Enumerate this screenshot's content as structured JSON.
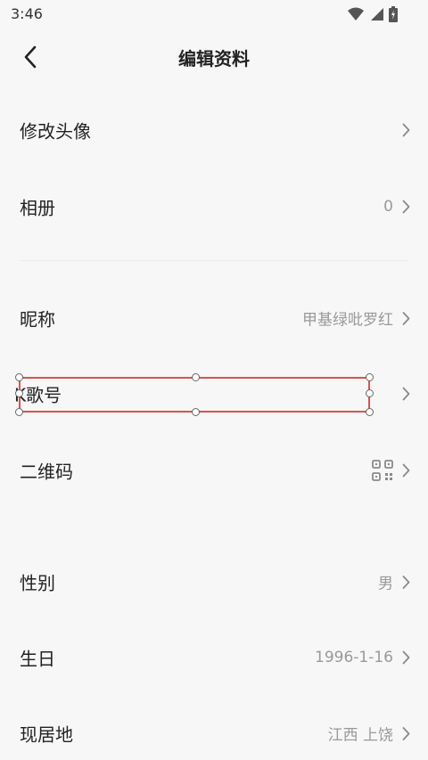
{
  "status_bar": {
    "time": "3:46"
  },
  "header": {
    "title": "编辑资料"
  },
  "rows": {
    "avatar": {
      "label": "修改头像"
    },
    "album": {
      "label": "相册",
      "value": "0"
    },
    "nickname": {
      "label": "昵称",
      "value": "甲基绿吡罗红"
    },
    "k_id": {
      "label": "K歌号"
    },
    "qr_code": {
      "label": "二维码",
      "icon": "qr-code-icon"
    },
    "gender": {
      "label": "性别",
      "value": "男"
    },
    "birthday": {
      "label": "生日",
      "value": "1996-1-16"
    },
    "location": {
      "label": "现居地",
      "value": "江西 上饶"
    }
  },
  "colors": {
    "background": "#f7f7f7",
    "text": "#222222",
    "value_text": "#999999",
    "chevron": "#8a8a8a",
    "selection": "#d9534f"
  }
}
